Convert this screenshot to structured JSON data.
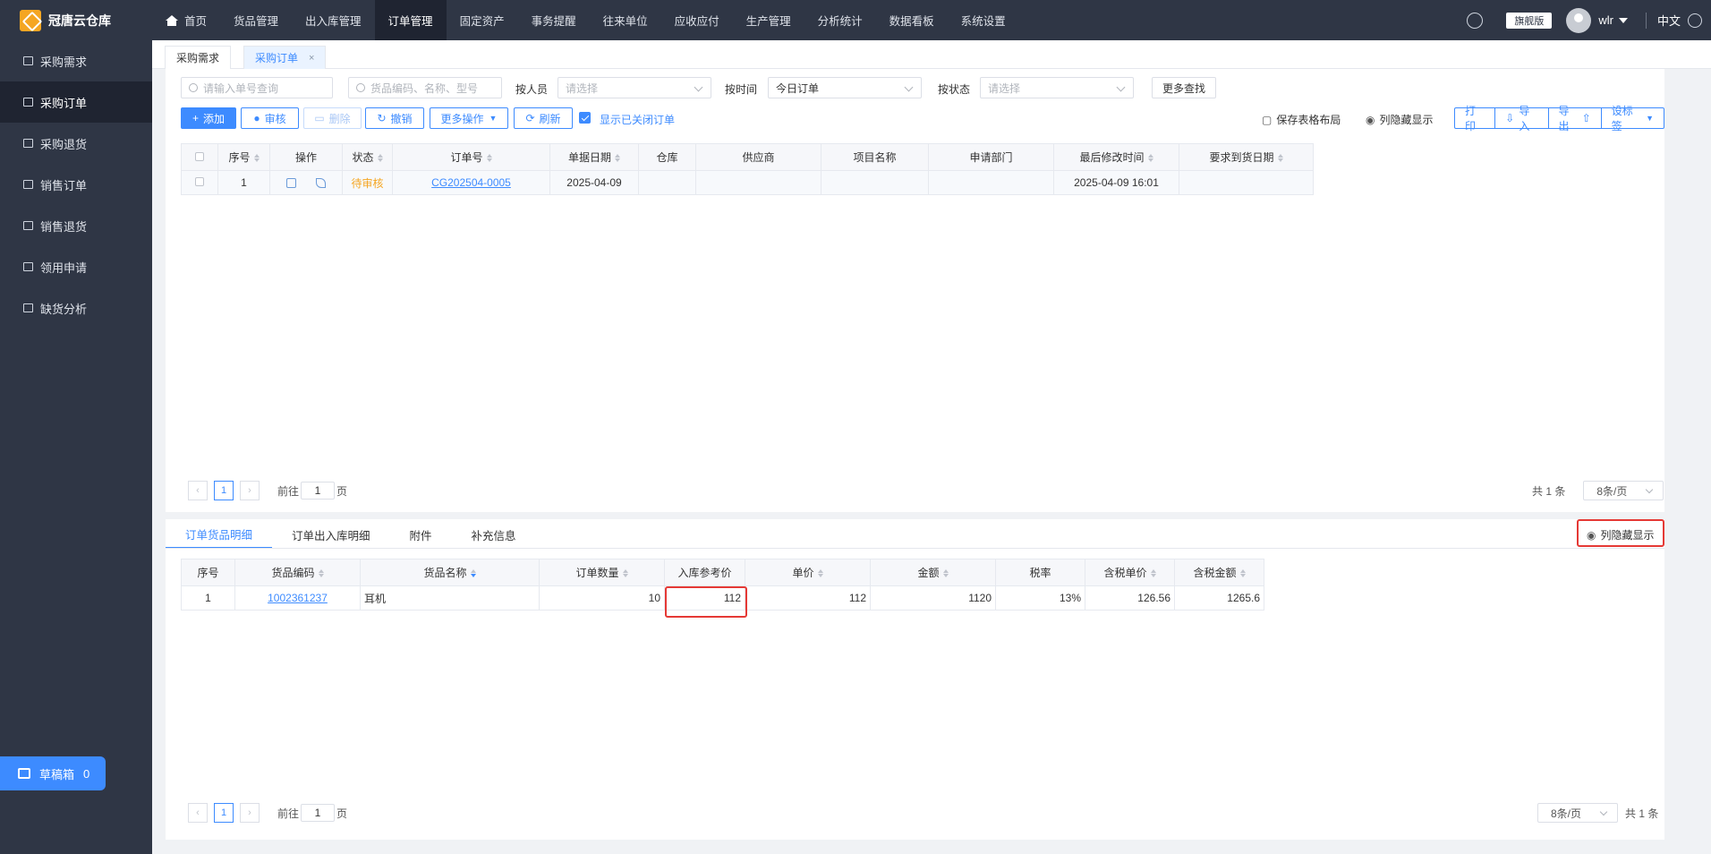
{
  "app": {
    "name": "冠唐云仓库",
    "edition": "旗舰版",
    "user": "wlr",
    "language": "中文"
  },
  "nav": [
    {
      "label": "首页",
      "icon": "home-icon"
    },
    {
      "label": "货品管理"
    },
    {
      "label": "出入库管理"
    },
    {
      "label": "订单管理",
      "active": true
    },
    {
      "label": "固定资产"
    },
    {
      "label": "事务提醒"
    },
    {
      "label": "往来单位"
    },
    {
      "label": "应收应付"
    },
    {
      "label": "生产管理"
    },
    {
      "label": "分析统计"
    },
    {
      "label": "数据看板"
    },
    {
      "label": "系统设置"
    }
  ],
  "sidebar": {
    "items": [
      {
        "label": "采购需求",
        "icon": "cart-icon"
      },
      {
        "label": "采购订单",
        "icon": "cart-icon",
        "active": true
      },
      {
        "label": "采购退货",
        "icon": "cart-icon"
      },
      {
        "label": "销售订单",
        "icon": "bag-icon"
      },
      {
        "label": "销售退货",
        "icon": "bag-icon"
      },
      {
        "label": "领用申请",
        "icon": "briefcase-icon"
      },
      {
        "label": "缺货分析",
        "icon": "cart-icon"
      }
    ],
    "draft": {
      "label": "草稿箱",
      "count": "0"
    }
  },
  "pagetabs": [
    {
      "label": "采购需求"
    },
    {
      "label": "采购订单",
      "active": true,
      "close": "×"
    }
  ],
  "filters": {
    "order_search_placeholder": "请输入单号查询",
    "goods_search_placeholder": "货品编码、名称、型号",
    "by_person_label": "按人员",
    "by_person_placeholder": "请选择",
    "by_time_label": "按时间",
    "by_time_value": "今日订单",
    "by_status_label": "按状态",
    "by_status_placeholder": "请选择",
    "more_search": "更多查找"
  },
  "toolbar": {
    "add": "添加",
    "audit": "审核",
    "delete": "删除",
    "revoke": "撤销",
    "more_ops": "更多操作",
    "refresh": "刷新",
    "show_closed": "显示已关闭订单",
    "save_layout": "保存表格布局",
    "column_toggle": "列隐藏显示",
    "print": "打印",
    "import": "导入",
    "export": "导出",
    "set_label": "设标签"
  },
  "orders_table": {
    "headers": [
      "序号",
      "操作",
      "状态",
      "订单号",
      "单据日期",
      "仓库",
      "供应商",
      "项目名称",
      "申请部门",
      "最后修改时间",
      "要求到货日期"
    ],
    "rows": [
      {
        "index": "1",
        "status": "待审核",
        "order_no": "CG202504-0005",
        "date": "2025-04-09",
        "warehouse": "",
        "supplier": "",
        "project": "",
        "department": "",
        "modified": "2025-04-09 16:01",
        "due": ""
      }
    ]
  },
  "orders_pager": {
    "page": "1",
    "goto_label": "前往",
    "goto_value": "1",
    "page_suffix": "页",
    "total": "共 1 条",
    "page_size": "8条/页"
  },
  "detail_tabs": [
    {
      "label": "订单货品明细",
      "active": true
    },
    {
      "label": "订单出入库明细"
    },
    {
      "label": "附件"
    },
    {
      "label": "补充信息"
    }
  ],
  "detail_column_toggle": "列隐藏显示",
  "detail_table": {
    "headers": [
      "序号",
      "货品编码",
      "货品名称",
      "订单数量",
      "入库参考价",
      "单价",
      "金额",
      "税率",
      "含税单价",
      "含税金额"
    ],
    "rows": [
      {
        "index": "1",
        "code": "1002361237",
        "name": "耳机",
        "qty": "10",
        "ref_price": "112",
        "unit_price": "112",
        "amount": "1120",
        "tax_rate": "13%",
        "tax_unit_price": "126.56",
        "tax_amount": "1265.6"
      }
    ]
  },
  "detail_pager": {
    "page": "1",
    "goto_label": "前往",
    "goto_value": "1",
    "page_suffix": "页",
    "total": "共 1 条",
    "page_size": "8条/页"
  },
  "colors": {
    "accent": "#3d8bff",
    "nav_bg": "#2f3645",
    "pending": "#f5a623",
    "highlight_box": "#e53935"
  }
}
